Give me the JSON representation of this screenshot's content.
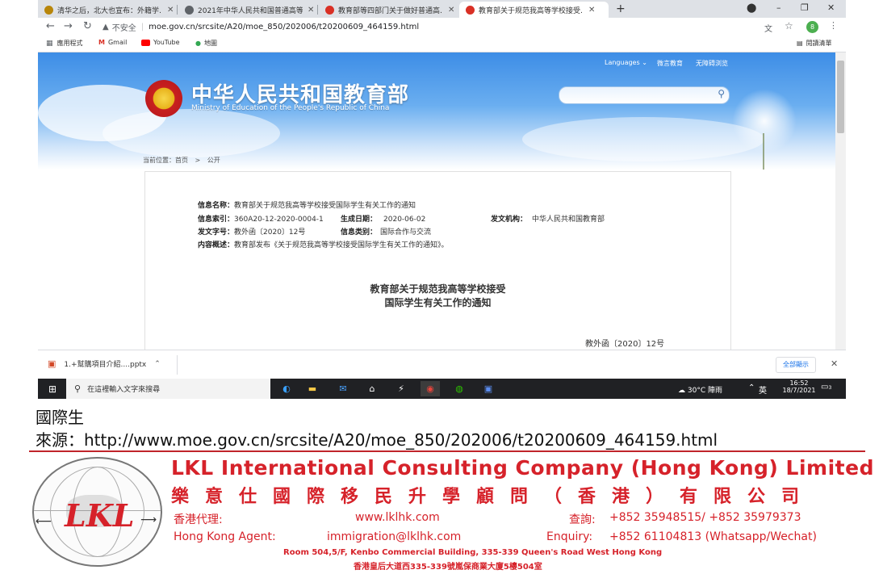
{
  "browser": {
    "tabs": [
      {
        "title": "清华之后，北大也宣布：外籍学…",
        "color": "#b8860b"
      },
      {
        "title": "2021年中华人民共和国普通高等…",
        "color": "#5f6368"
      },
      {
        "title": "教育部等四部门关于做好普通高…",
        "color": "#d93025"
      },
      {
        "title": "教育部关于规范我高等学校接受…",
        "color": "#d93025"
      }
    ],
    "new_tab_symbol": "+",
    "security_label": "不安全",
    "url": "moe.gov.cn/srcsite/A20/moe_850/202006/t20200609_464159.html",
    "profile_initial": "8",
    "bookmarks": [
      "應用程式",
      "Gmail",
      "YouTube",
      "地圖"
    ],
    "reading_list": "閱讀清單"
  },
  "site": {
    "title_zh": "中华人民共和国教育部",
    "title_en": "Ministry of Education of the People's Republic of China",
    "top_links": [
      "Languages",
      "微言教育",
      "无障碍浏览"
    ],
    "breadcrumb": [
      "当前位置：首页",
      ">",
      "公开"
    ]
  },
  "document": {
    "meta": {
      "name_label": "信息名称：",
      "name_value": "教育部关于规范我高等学校接受国际学生有关工作的通知",
      "index_label": "信息索引：",
      "index_value": "360A20-12-2020-0004-1",
      "date_label": "生成日期：",
      "date_value": "2020-06-02",
      "agency_label": "发文机构：",
      "agency_value": "中华人民共和国教育部",
      "docno_label": "发文字号：",
      "docno_value": "教外函〔2020〕12号",
      "category_label": "信息类别：",
      "category_value": "国际合作与交流",
      "summary_label": "内容概述：",
      "summary_value": "教育部发布《关于规范我高等学校接受国际学生有关工作的通知》。"
    },
    "heading_line1": "教育部关于规范我高等学校接受",
    "heading_line2": "国际学生有关工作的通知",
    "number": "教外函〔2020〕12号"
  },
  "download": {
    "file": "1.+幫購項目介紹....pptx",
    "show_all": "全部顯示"
  },
  "taskbar": {
    "search_placeholder": "在這裡輸入文字來搜尋",
    "weather": "30°C 陣雨",
    "ime": "英",
    "time": "16:52",
    "date": "18/7/2021",
    "notif_count": "3"
  },
  "caption": {
    "line1": "國際生",
    "source_label": "來源：",
    "source_url": "http://www.moe.gov.cn/srcsite/A20/moe_850/202006/t20200609_464159.html"
  },
  "footer": {
    "logo_text": "LKL",
    "company_en": "LKL International Consulting Company (Hong Kong) Limited",
    "company_zh": "樂意仕國際移民升學顧問（香港）有限公司",
    "agent_zh_label": "香港代理:",
    "website": "www.lklhk.com",
    "enquiry_zh_label": "查詢:",
    "phones": "+852 35948515/ +852 35979373",
    "agent_en_label": "Hong Kong Agent:",
    "email": "immigration@lklhk.com",
    "enquiry_en_label": "Enquiry:",
    "whatsapp": "+852 61104813 (Whatsapp/Wechat)",
    "address_en": "Room 504,5/F, Kenbo Commercial Building, 335-339 Queen's Road West Hong Kong",
    "address_zh": "香港皇后大道西335-339號嵐保商業大廈5樓504室"
  },
  "colors": {
    "brand_red": "#d6222a",
    "hero_blue": "#3d8de6"
  }
}
